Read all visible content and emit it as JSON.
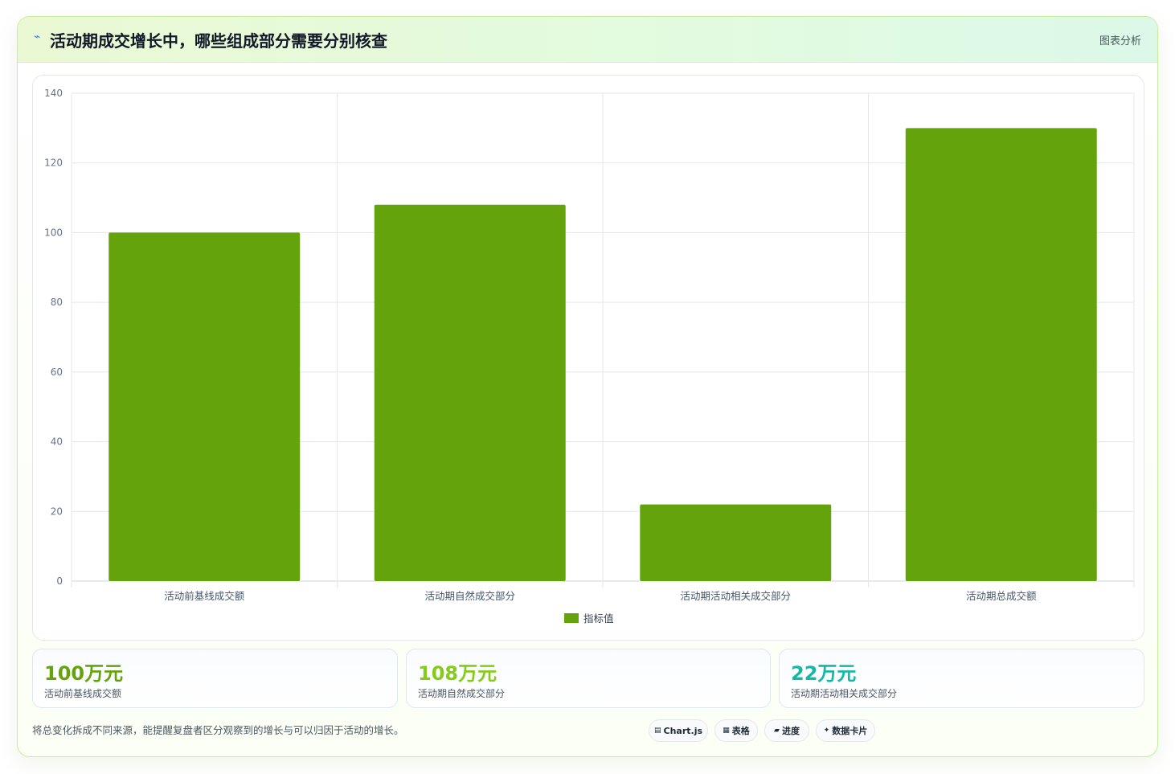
{
  "header": {
    "title_icon": "chart-line-icon",
    "title": "活动期成交增长中，哪些组成部分需要分别核查",
    "badge": "图表分析"
  },
  "chart_data": {
    "type": "bar",
    "categories": [
      "活动前基线成交额",
      "活动期自然成交部分",
      "活动期活动相关成交部分",
      "活动期总成交额"
    ],
    "series": [
      {
        "name": "指标值",
        "values": [
          100,
          108,
          22,
          130
        ],
        "color": "#65a30d"
      }
    ],
    "ylim": [
      0,
      140
    ],
    "yticks": [
      0,
      20,
      40,
      60,
      80,
      100,
      120,
      140
    ],
    "grid": true,
    "legend": "bottom"
  },
  "stats": [
    {
      "value": "100万元",
      "label": "活动前基线成交额",
      "color": "#65a30d"
    },
    {
      "value": "108万元",
      "label": "活动期自然成交部分",
      "color": "#84cc16"
    },
    {
      "value": "22万元",
      "label": "活动期活动相关成交部分",
      "color": "#14b8a6"
    }
  ],
  "footnote": "将总变化拆成不同来源，能提醒复盘者区分观察到的增长与可以归因于活动的增长。",
  "chips": [
    {
      "icon": "▤",
      "icon_name": "chart-icon",
      "label": "Chart.js"
    },
    {
      "icon": "▦",
      "icon_name": "table-icon",
      "label": "表格"
    },
    {
      "icon": "▰",
      "icon_name": "progress-icon",
      "label": "进度"
    },
    {
      "icon": "✦",
      "icon_name": "sparkle-icon",
      "label": "数据卡片"
    }
  ]
}
